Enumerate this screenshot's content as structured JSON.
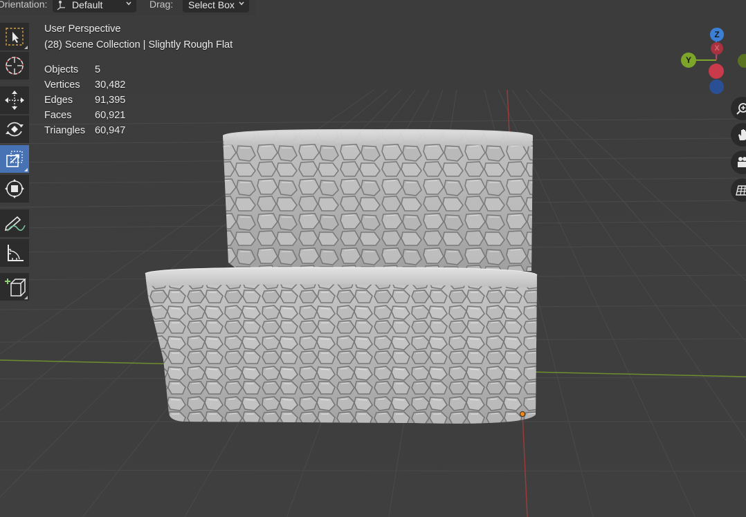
{
  "header": {
    "orientation_label": "Orientation:",
    "orientation_value": "Default",
    "drag_label": "Drag:",
    "drag_value": "Select Box"
  },
  "viewport": {
    "view_name": "User Perspective",
    "collection_line": "(28) Scene Collection | Slightly Rough Flat",
    "stats": [
      {
        "label": "Objects",
        "value": "5"
      },
      {
        "label": "Vertices",
        "value": "30,482"
      },
      {
        "label": "Edges",
        "value": "91,395"
      },
      {
        "label": "Faces",
        "value": "60,921"
      },
      {
        "label": "Triangles",
        "value": "60,947"
      }
    ]
  },
  "toolbar": {
    "tools": [
      {
        "name": "select-box-tool",
        "icon": "select-box-icon",
        "active": false
      },
      {
        "name": "cursor-tool",
        "icon": "cursor-icon",
        "active": false
      },
      {
        "name": "move-tool",
        "icon": "move-icon",
        "active": false
      },
      {
        "name": "rotate-tool",
        "icon": "rotate-icon",
        "active": false
      },
      {
        "name": "scale-tool",
        "icon": "scale-icon",
        "active": true
      },
      {
        "name": "transform-tool",
        "icon": "transform-icon",
        "active": false
      },
      {
        "name": "annotate-tool",
        "icon": "annotate-icon",
        "active": false
      },
      {
        "name": "measure-tool",
        "icon": "measure-icon",
        "active": false
      },
      {
        "name": "add-cube-tool",
        "icon": "add-cube-icon",
        "active": false
      }
    ]
  },
  "gizmo": {
    "z_label": "Z",
    "y_label": "Y",
    "x_label": "X",
    "colors": {
      "x": "#c93a4a",
      "y": "#7ca52a",
      "z": "#3b80d6",
      "x_neg": "#2b4f94"
    }
  },
  "navigation": {
    "buttons": [
      "zoom-icon",
      "hand-pan-icon",
      "camera-icon",
      "ortho-grid-icon"
    ]
  },
  "colors": {
    "background": "#3d3d3d",
    "toolbar_bg": "#2c2c2c",
    "active_tool": "#4772b3",
    "stone": "#b8b8b8"
  }
}
